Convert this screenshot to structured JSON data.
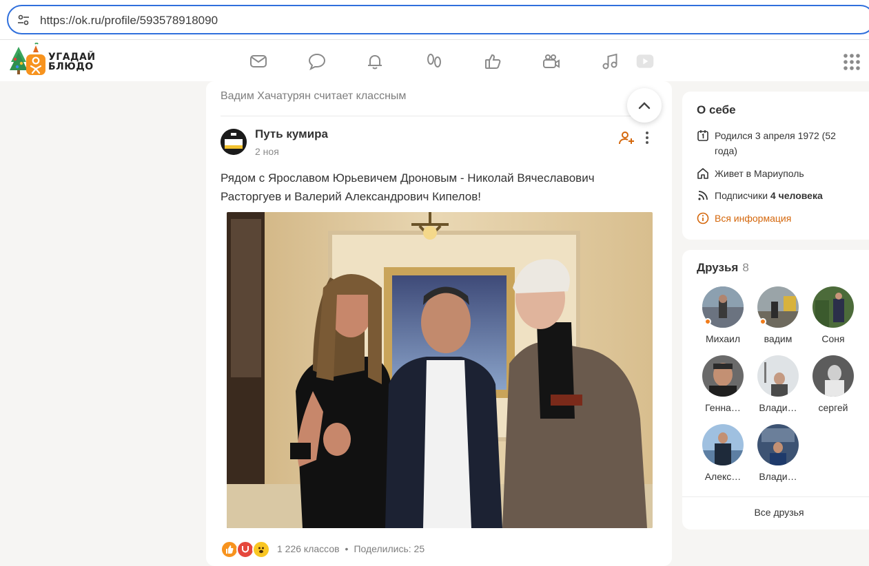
{
  "browser": {
    "url": "https://ok.ru/profile/593578918090"
  },
  "logo": {
    "line1": "УГАДАЙ",
    "line2": "БЛЮДО"
  },
  "nav": {
    "icons": [
      "mail-icon",
      "chat-icon",
      "bell-icon",
      "guests-icon",
      "like-icon",
      "video-icon",
      "music-icon",
      "play-icon"
    ]
  },
  "feed": {
    "liked_by": "Вадим Хачатурян считает классным",
    "post": {
      "group_name": "Путь кумира",
      "group_avatar_text": "ПУТЬ КУМИРА",
      "date": "2 ноя",
      "text": "Рядом с Ярославом Юрьевичем Дроновым - Николай Вячеславович Расторгуев и Валерий Александрович Кипелов!",
      "likes": "1 226 классов",
      "separator": "•",
      "shares": "Поделились: 25"
    }
  },
  "about": {
    "title": "О себе",
    "born": "Родился 3 апреля 1972 (52 года)",
    "lives": "Живет в Мариуполь",
    "followers_label": "Подписчики",
    "followers_value": "4 человека",
    "all_info": "Вся информация"
  },
  "friends": {
    "title": "Друзья",
    "count": "8",
    "items": [
      {
        "name": "Михаил",
        "online": true
      },
      {
        "name": "вадим",
        "online": true
      },
      {
        "name": "Соня",
        "online": false
      },
      {
        "name": "Генна…",
        "online": false
      },
      {
        "name": "Влади…",
        "online": false
      },
      {
        "name": "сергей",
        "online": false
      },
      {
        "name": "Алекс…",
        "online": false
      },
      {
        "name": "Влади…",
        "online": false
      }
    ],
    "all_label": "Все друзья"
  },
  "colors": {
    "accent": "#d4660a",
    "url_border": "#2f6fdc",
    "background": "#f6f5f3"
  }
}
